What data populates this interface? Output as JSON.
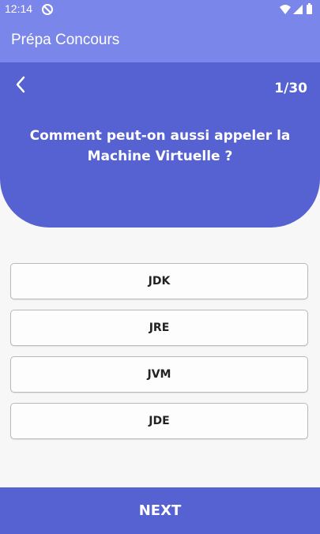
{
  "status": {
    "time": "12:14"
  },
  "appbar": {
    "title": "Prépa Concours"
  },
  "quiz": {
    "progress": "1/30",
    "question": "Comment peut-on aussi appeler la Machine Virtuelle ?",
    "options": [
      "JDK",
      "JRE",
      "JVM",
      "JDE"
    ]
  },
  "footer": {
    "next_label": "NEXT"
  },
  "colors": {
    "appbar": "#7b86ea",
    "primary": "#5661d2",
    "background": "#f7f7f7"
  },
  "icons": [
    "app-notification-icon",
    "wifi-icon",
    "signal-icon",
    "battery-icon",
    "back-arrow-icon"
  ]
}
